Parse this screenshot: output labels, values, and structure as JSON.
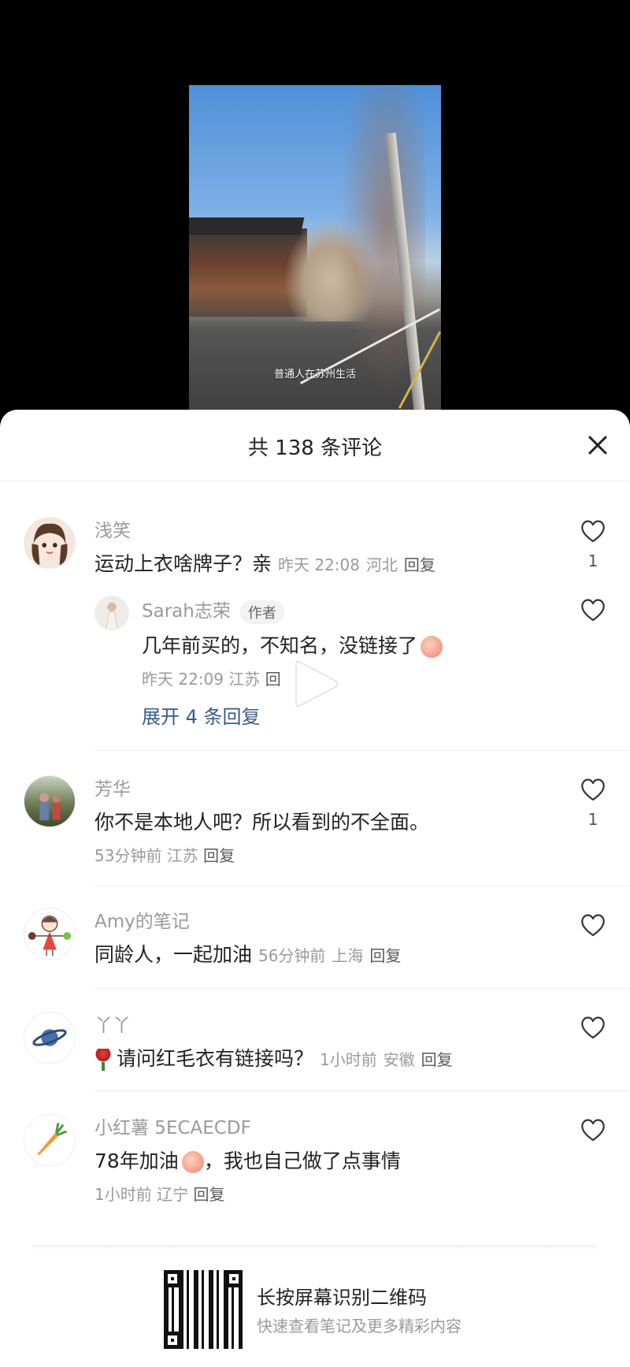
{
  "video": {
    "caption": "普通人在苏州生活"
  },
  "sheet": {
    "title": "共 138 条评论"
  },
  "comments": [
    {
      "name": "浅笑",
      "text": "运动上衣啥牌子？亲",
      "time": "昨天 22:08",
      "location": "河北",
      "reply_label": "回复",
      "likes": "1",
      "avatar_icon": "girl-avatar-icon"
    },
    {
      "name": "芳华",
      "text": "你不是本地人吧？所以看到的不全面。",
      "time": "53分钟前",
      "location": "江苏",
      "reply_label": "回复",
      "likes": "1",
      "avatar_icon": "photo-avatar-icon"
    },
    {
      "name": "Amy的笔记",
      "text": "同龄人，一起加油",
      "time": "56分钟前",
      "location": "上海",
      "reply_label": "回复",
      "avatar_icon": "cartoon-girl-avatar-icon"
    },
    {
      "name": "丫丫",
      "text": "请问红毛衣有链接吗？",
      "time": "1小时前",
      "location": "安徽",
      "reply_label": "回复",
      "avatar_icon": "planet-avatar-icon"
    },
    {
      "name": "小红薯 5ECAECDF",
      "text": "78年加油",
      "text_tail": "，我也自己做了点事情",
      "time": "1小时前",
      "location": "辽宁",
      "reply_label": "回复",
      "avatar_icon": "carrot-avatar-icon"
    }
  ],
  "reply": {
    "name": "Sarah志荣",
    "tag": "作者",
    "text": "几年前买的，不知名，没链接了",
    "time": "昨天 22:09",
    "location": "江苏",
    "reply_label": "回",
    "expand_label": "展开 4 条回复"
  },
  "footer": {
    "qr_title": "长按屏幕识别二维码",
    "qr_subtitle": "快速查看笔记及更多精彩内容"
  },
  "colors": {
    "background": "#000000",
    "sheet": "#ffffff",
    "meta_text": "#9a9a9a",
    "link_blue": "#3b5a85"
  }
}
